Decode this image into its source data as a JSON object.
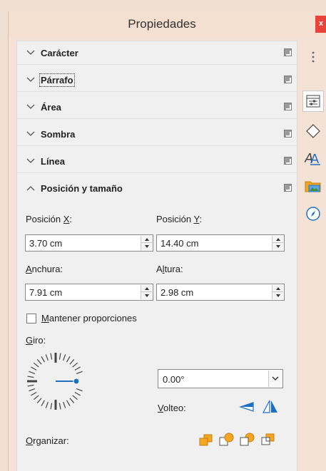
{
  "window": {
    "title": "Propiedades",
    "close_label": "x"
  },
  "sections": [
    {
      "label": "Carácter",
      "expanded": false
    },
    {
      "label": "Párrafo",
      "expanded": false
    },
    {
      "label": "Área",
      "expanded": false
    },
    {
      "label": "Sombra",
      "expanded": false
    },
    {
      "label": "Línea",
      "expanded": false
    },
    {
      "label": "Posición y tamaño",
      "expanded": true
    }
  ],
  "position_size": {
    "pos_x": {
      "label_pre": "Posición ",
      "label_key": "X",
      "label_post": ":",
      "value": "3.70 cm"
    },
    "pos_y": {
      "label_pre": "Posición ",
      "label_key": "Y",
      "label_post": ":",
      "value": "14.40 cm"
    },
    "width": {
      "label_pre": "",
      "label_key": "A",
      "label_post": "nchura:",
      "value": "7.91 cm"
    },
    "height": {
      "label_pre": "A",
      "label_key": "l",
      "label_post": "tura:",
      "value": "2.98 cm"
    },
    "keep_ratio": {
      "label_key": "M",
      "label_post": "antener proporciones",
      "checked": false
    },
    "rotation": {
      "label_key": "G",
      "label_post": "iro:",
      "value": "0.00°",
      "dial_angle_deg": 0
    },
    "flip": {
      "label_key": "V",
      "label_post": "olteo:"
    },
    "arrange": {
      "label_key": "O",
      "label_post": "rganizar:"
    }
  },
  "deck": {
    "items": [
      {
        "name": "menu",
        "icon": "vertical-dots-icon"
      },
      {
        "name": "properties",
        "icon": "properties-icon",
        "active": true
      },
      {
        "name": "shapes",
        "icon": "diamond-icon"
      },
      {
        "name": "styles",
        "icon": "styles-icon"
      },
      {
        "name": "gallery",
        "icon": "gallery-icon"
      },
      {
        "name": "navigator",
        "icon": "compass-icon"
      }
    ]
  },
  "colors": {
    "window_bg": "#f5e2d7",
    "panel_bg": "#f0f0f0",
    "accent_blue": "#1f6fc1",
    "close_red": "#e8423a",
    "arrange_orange": "#f5a623"
  }
}
